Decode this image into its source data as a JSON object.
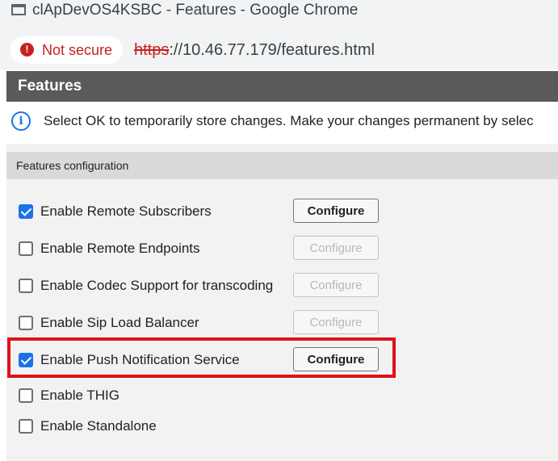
{
  "window": {
    "title": "clApDevOS4KSBC - Features - Google Chrome",
    "app_icon": "window-icon"
  },
  "addressbar": {
    "security_label": "Not secure",
    "security_icon": "warning-icon",
    "url_scheme": "https",
    "url_rest": "://10.46.77.179/features.html"
  },
  "page": {
    "header_title": "Features",
    "info_icon": "info-icon",
    "info_message": "Select OK to temporarily store changes. Make your changes permanent by selec",
    "section_title": "Features configuration"
  },
  "features": [
    {
      "label": "Enable Remote Subscribers",
      "checked": true,
      "configure": "Configure",
      "configure_enabled": true
    },
    {
      "label": "Enable Remote Endpoints",
      "checked": false,
      "configure": "Configure",
      "configure_enabled": false
    },
    {
      "label": "Enable Codec Support for transcoding",
      "checked": false,
      "configure": "Configure",
      "configure_enabled": false
    },
    {
      "label": "Enable Sip Load Balancer",
      "checked": false,
      "configure": "Configure",
      "configure_enabled": false
    },
    {
      "label": "Enable Push Notification Service",
      "checked": true,
      "configure": "Configure",
      "configure_enabled": true,
      "highlighted": true
    },
    {
      "label": "Enable THIG",
      "checked": false
    },
    {
      "label": "Enable Standalone",
      "checked": false
    }
  ],
  "colors": {
    "header_bg": "#5a5a5a",
    "section_bg": "#d9d9d9",
    "content_bg": "#f2f2f2",
    "checkbox_checked": "#1a73e8",
    "highlight_border": "#e0101a",
    "not_secure": "#c5221f"
  }
}
